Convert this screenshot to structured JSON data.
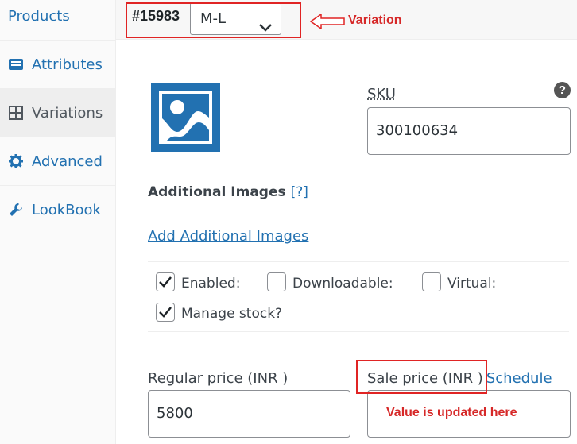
{
  "sidebar": {
    "items": [
      {
        "label": "Products",
        "icon": "none"
      },
      {
        "label": "Attributes",
        "icon": "list-icon"
      },
      {
        "label": "Variations",
        "icon": "grid-icon"
      },
      {
        "label": "Advanced",
        "icon": "gear-icon"
      },
      {
        "label": "LookBook",
        "icon": "wrench-icon"
      }
    ]
  },
  "variation": {
    "id": "#15983",
    "selected": "M-L"
  },
  "annotations": {
    "variation_label": "Variation",
    "sale_note": "Value is updated here",
    "color": "#d62828"
  },
  "sku": {
    "label": "SKU",
    "value": "300100634"
  },
  "additional_images": {
    "title": "Additional Images",
    "help": "[?]",
    "link": "Add Additional Images"
  },
  "options": {
    "enabled": {
      "label": "Enabled:",
      "checked": true
    },
    "downloadable": {
      "label": "Downloadable:",
      "checked": false
    },
    "virtual": {
      "label": "Virtual:",
      "checked": false
    },
    "manage_stock": {
      "label": "Manage stock?",
      "checked": true
    }
  },
  "pricing": {
    "regular_label": "Regular price (INR )",
    "regular_value": "5800",
    "sale_label": "Sale price (INR )",
    "schedule_link": "Schedule"
  },
  "colors": {
    "link": "#2271b1",
    "annotation": "#e02424"
  }
}
